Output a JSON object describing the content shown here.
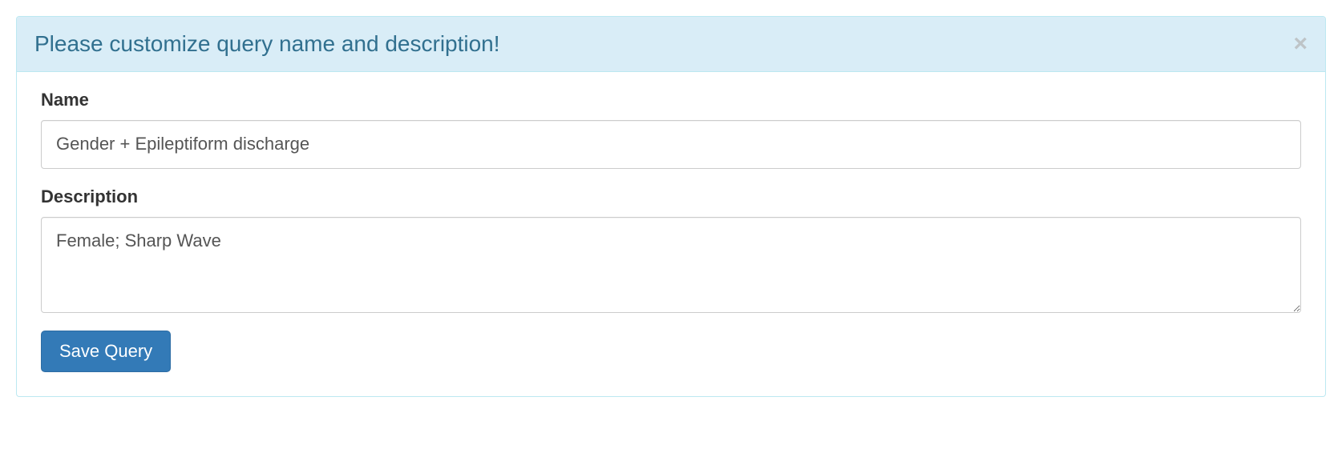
{
  "panel": {
    "title": "Please customize query name and description!"
  },
  "form": {
    "name": {
      "label": "Name",
      "value": "Gender + Epileptiform discharge"
    },
    "description": {
      "label": "Description",
      "value": "Female; Sharp Wave"
    },
    "save_button_label": "Save Query"
  }
}
